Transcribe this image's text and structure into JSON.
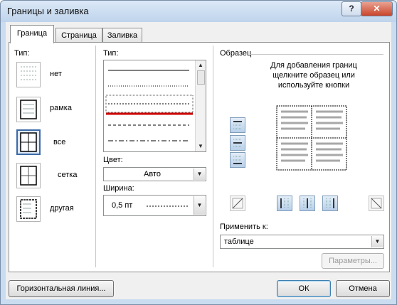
{
  "window": {
    "title": "Границы и заливка",
    "help": "?",
    "close": "✕"
  },
  "tabs": [
    {
      "label": "Граница",
      "active": true
    },
    {
      "label": "Страница",
      "active": false
    },
    {
      "label": "Заливка",
      "active": false
    }
  ],
  "settings": {
    "label": "Тип:",
    "items": [
      "нет",
      "рамка",
      "все",
      "сетка",
      "другая"
    ],
    "selected": "все"
  },
  "style": {
    "label": "Тип:",
    "selected_index": 2
  },
  "color": {
    "label": "Цвет:",
    "value": "Авто"
  },
  "width": {
    "label": "Ширина:",
    "value": "0,5 пт"
  },
  "preview": {
    "label": "Образец",
    "hint": "Для добавления границ щелкните образец или используйте кнопки"
  },
  "apply_to": {
    "label": "Применить к:",
    "value": "таблице"
  },
  "buttons": {
    "options": "Параметры...",
    "horizontal_line": "Горизонтальная линия...",
    "ok": "ОК",
    "cancel": "Отмена"
  },
  "colors": {
    "selection_red": "#cc0000",
    "title_bar": "#c9dcf0"
  }
}
